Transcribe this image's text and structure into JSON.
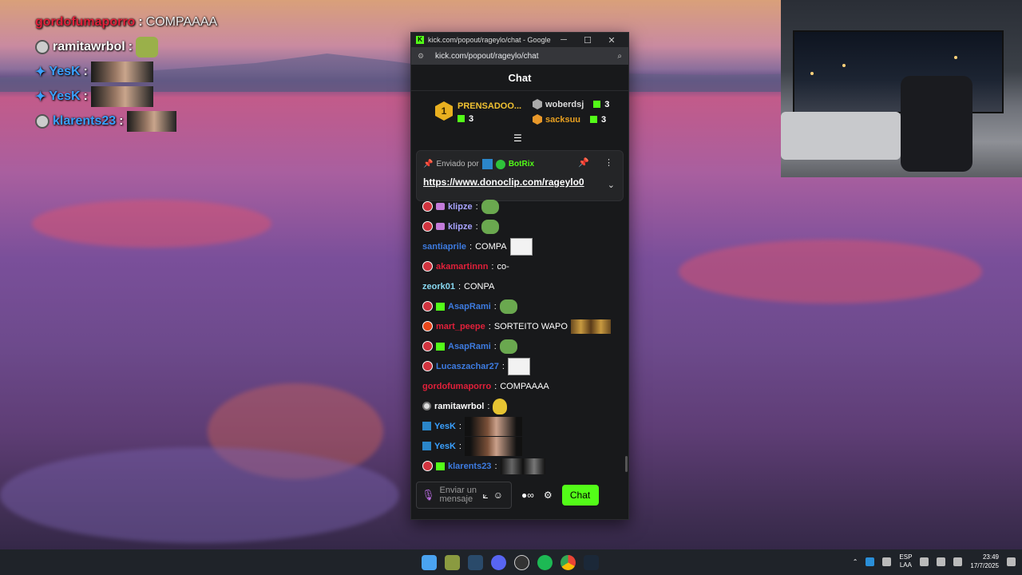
{
  "overlay_chat": [
    {
      "user": "gordofumaporro",
      "message": "COMPAAAA",
      "color": "#e0203a"
    },
    {
      "user": "ramitawrbol",
      "message": ":",
      "color": "#ffffff"
    },
    {
      "user": "YesK",
      "message": ":",
      "color": "#3aa0ff"
    },
    {
      "user": "YesK",
      "message": ":",
      "color": "#3aa0ff"
    },
    {
      "user": "klarents23",
      "message": ":",
      "color": "#3aa0ff"
    }
  ],
  "window": {
    "title": "kick.com/popout/rageylo/chat - Google Chr...",
    "url": "kick.com/popout/rageylo/chat",
    "minimize": "─",
    "maximize": "☐",
    "close": "✕"
  },
  "chat": {
    "header": "Chat",
    "leaderboard": {
      "rank1": "1",
      "first": {
        "name": "PRENSADOO...",
        "count": "3"
      },
      "second": {
        "name": "woberdsj",
        "count": "3"
      },
      "third": {
        "name": "sacksuu",
        "count": "3"
      }
    },
    "pinned": {
      "sent_by": "Enviado por",
      "author": "BotRix",
      "link": "https://www.donoclip.com/rageylo0"
    },
    "messages": [
      {
        "user": "klipze",
        "sep": ":",
        "text": "",
        "color": "#a7a2ff"
      },
      {
        "user": "klipze",
        "sep": ":",
        "text": "",
        "color": "#a7a2ff"
      },
      {
        "user": "santiaprile",
        "sep": ":",
        "text": "COMPA",
        "color": "#3d7be0"
      },
      {
        "user": "akamartinnn",
        "sep": ":",
        "text": "co-",
        "color": "#e0203a"
      },
      {
        "user": "zeork01",
        "sep": ":",
        "text": "CONPA",
        "color": "#88d8f0"
      },
      {
        "user": "AsapRami",
        "sep": ":",
        "text": "",
        "color": "#3d7be0"
      },
      {
        "user": "mart_peepe",
        "sep": ":",
        "text": "SORTEITO WAPO",
        "color": "#e0203a"
      },
      {
        "user": "AsapRami",
        "sep": ":",
        "text": "",
        "color": "#3d7be0"
      },
      {
        "user": "Lucaszachar27",
        "sep": ":",
        "text": "",
        "color": "#3d7be0"
      },
      {
        "user": "gordofumaporro",
        "sep": ":",
        "text": "COMPAAAA",
        "color": "#e0203a"
      },
      {
        "user": "ramitawrbol",
        "sep": ":",
        "text": "",
        "color": "#ffffff"
      },
      {
        "user": "YesK",
        "sep": ":",
        "text": "",
        "color": "#3aa0ff"
      },
      {
        "user": "YesK",
        "sep": ":",
        "text": "",
        "color": "#3aa0ff"
      },
      {
        "user": "klarents23",
        "sep": ":",
        "text": "",
        "color": "#3d7be0"
      }
    ],
    "input_placeholder": "Enviar un mensaje",
    "send_label": "Chat"
  },
  "taskbar": {
    "lang_top": "ESP",
    "lang_bottom": "LAA",
    "time": "23:49",
    "date": "17/7/2025"
  },
  "colors": {
    "kick_green": "#53fc18",
    "chat_bg": "#18191b"
  }
}
